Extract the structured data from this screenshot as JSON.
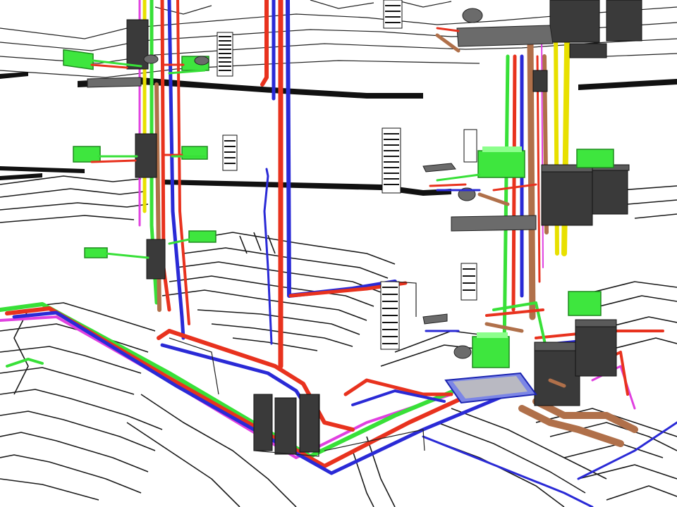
{
  "colors": {
    "background": "#ffffff",
    "floor_heating_coil": "#1a1a1a",
    "hot_water_pipe": "#e8321e",
    "cold_water_pipe": "#2a2ad6",
    "heating_pipe": "#38e038",
    "gas_pipe": "#e6e000",
    "circulation_pipe": "#e040e0",
    "sewage_pipe": "#b0704a",
    "manifold_unit": "#3ee63e",
    "boiler_unit": "#3a3a3a",
    "shower_tray": "#7c86e6"
  },
  "icons": {
    "floor_heating": "floor-coil-icon",
    "manifold": "manifold-box-icon",
    "radiator": "towel-radiator-icon",
    "boiler": "boiler-icon",
    "toilet": "toilet-icon",
    "sink": "washbasin-icon",
    "shower": "shower-tray-icon"
  }
}
